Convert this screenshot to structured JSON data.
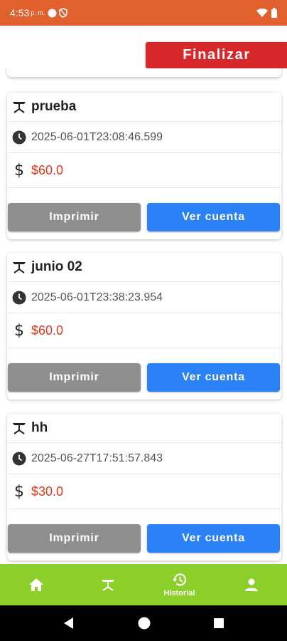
{
  "status_bar": {
    "time": "4:53",
    "ampm": "p. m."
  },
  "header": {
    "finalize_label": "Finalizar"
  },
  "orders": [
    {
      "name": "prueba",
      "datetime": "2025-06-01T23:08:46.599",
      "total": "$60.0",
      "print_label": "Imprimir",
      "view_label": "Ver cuenta"
    },
    {
      "name": "junio 02",
      "datetime": "2025-06-01T23:38:23.954",
      "total": "$60.0",
      "print_label": "Imprimir",
      "view_label": "Ver cuenta"
    },
    {
      "name": "hh",
      "datetime": "2025-06-27T17:51:57.843",
      "total": "$30.0",
      "print_label": "Imprimir",
      "view_label": "Ver cuenta"
    }
  ],
  "bottom_nav": {
    "items": [
      {
        "icon": "home-icon",
        "label": ""
      },
      {
        "icon": "table-icon",
        "label": ""
      },
      {
        "icon": "history-icon",
        "label": "Historial",
        "active": true
      },
      {
        "icon": "person-icon",
        "label": ""
      }
    ]
  },
  "colors": {
    "status_bar": "#e0602e",
    "finalize": "#d8282c",
    "print_button": "#8e8e8e",
    "view_button": "#2a82f6",
    "total_text": "#e0381c",
    "bottom_nav": "#8ccf2a"
  }
}
